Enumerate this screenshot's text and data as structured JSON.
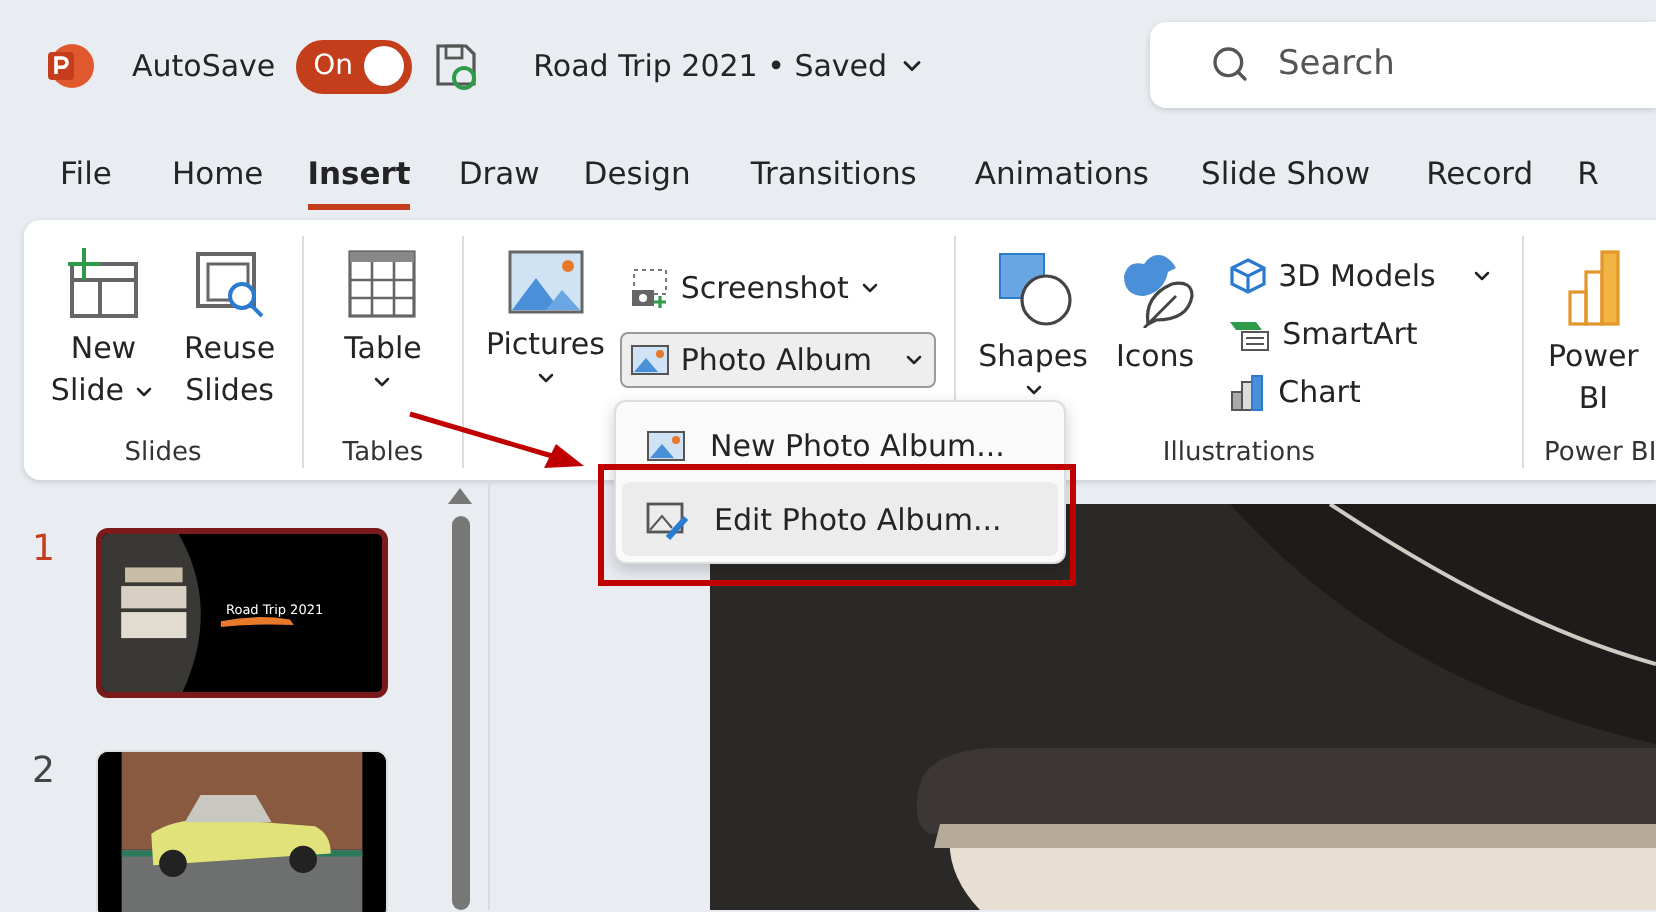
{
  "title_bar": {
    "autosave_label": "AutoSave",
    "autosave": {
      "on": true,
      "label": "On"
    },
    "document_title": "Road Trip 2021 • Saved",
    "search": {
      "placeholder": "Search"
    }
  },
  "tabs": [
    {
      "label": "File",
      "selected": false
    },
    {
      "label": "Home",
      "selected": false
    },
    {
      "label": "Insert",
      "selected": true
    },
    {
      "label": "Draw",
      "selected": false
    },
    {
      "label": "Design",
      "selected": false
    },
    {
      "label": "Transitions",
      "selected": false
    },
    {
      "label": "Animations",
      "selected": false
    },
    {
      "label": "Slide Show",
      "selected": false
    },
    {
      "label": "Record",
      "selected": false
    },
    {
      "label": "R",
      "selected": false
    }
  ],
  "ribbon": {
    "slides_group": {
      "label": "Slides",
      "new_slide": [
        "New",
        "Slide"
      ],
      "reuse_slides": [
        "Reuse",
        "Slides"
      ]
    },
    "tables_group": {
      "label": "Tables",
      "table": "Table"
    },
    "images_group": {
      "pictures": "Pictures",
      "screenshot": "Screenshot",
      "photo_album": {
        "label": "Photo Album",
        "pressed": true
      }
    },
    "illustrations_group": {
      "label": "Illustrations",
      "shapes": "Shapes",
      "icons": "Icons",
      "models_3d": "3D Models",
      "smartart": "SmartArt",
      "chart": "Chart"
    },
    "power_bi_group": {
      "label": "Power BI",
      "power_bi": [
        "Power",
        "BI"
      ]
    }
  },
  "photo_album_menu": {
    "items": [
      {
        "label": "New Photo Album...",
        "highlighted": false
      },
      {
        "label": "Edit Photo Album...",
        "highlighted": true
      }
    ]
  },
  "slides": [
    {
      "number": "1",
      "selected": true,
      "title": "Road Trip 2021"
    },
    {
      "number": "2",
      "selected": false
    }
  ]
}
